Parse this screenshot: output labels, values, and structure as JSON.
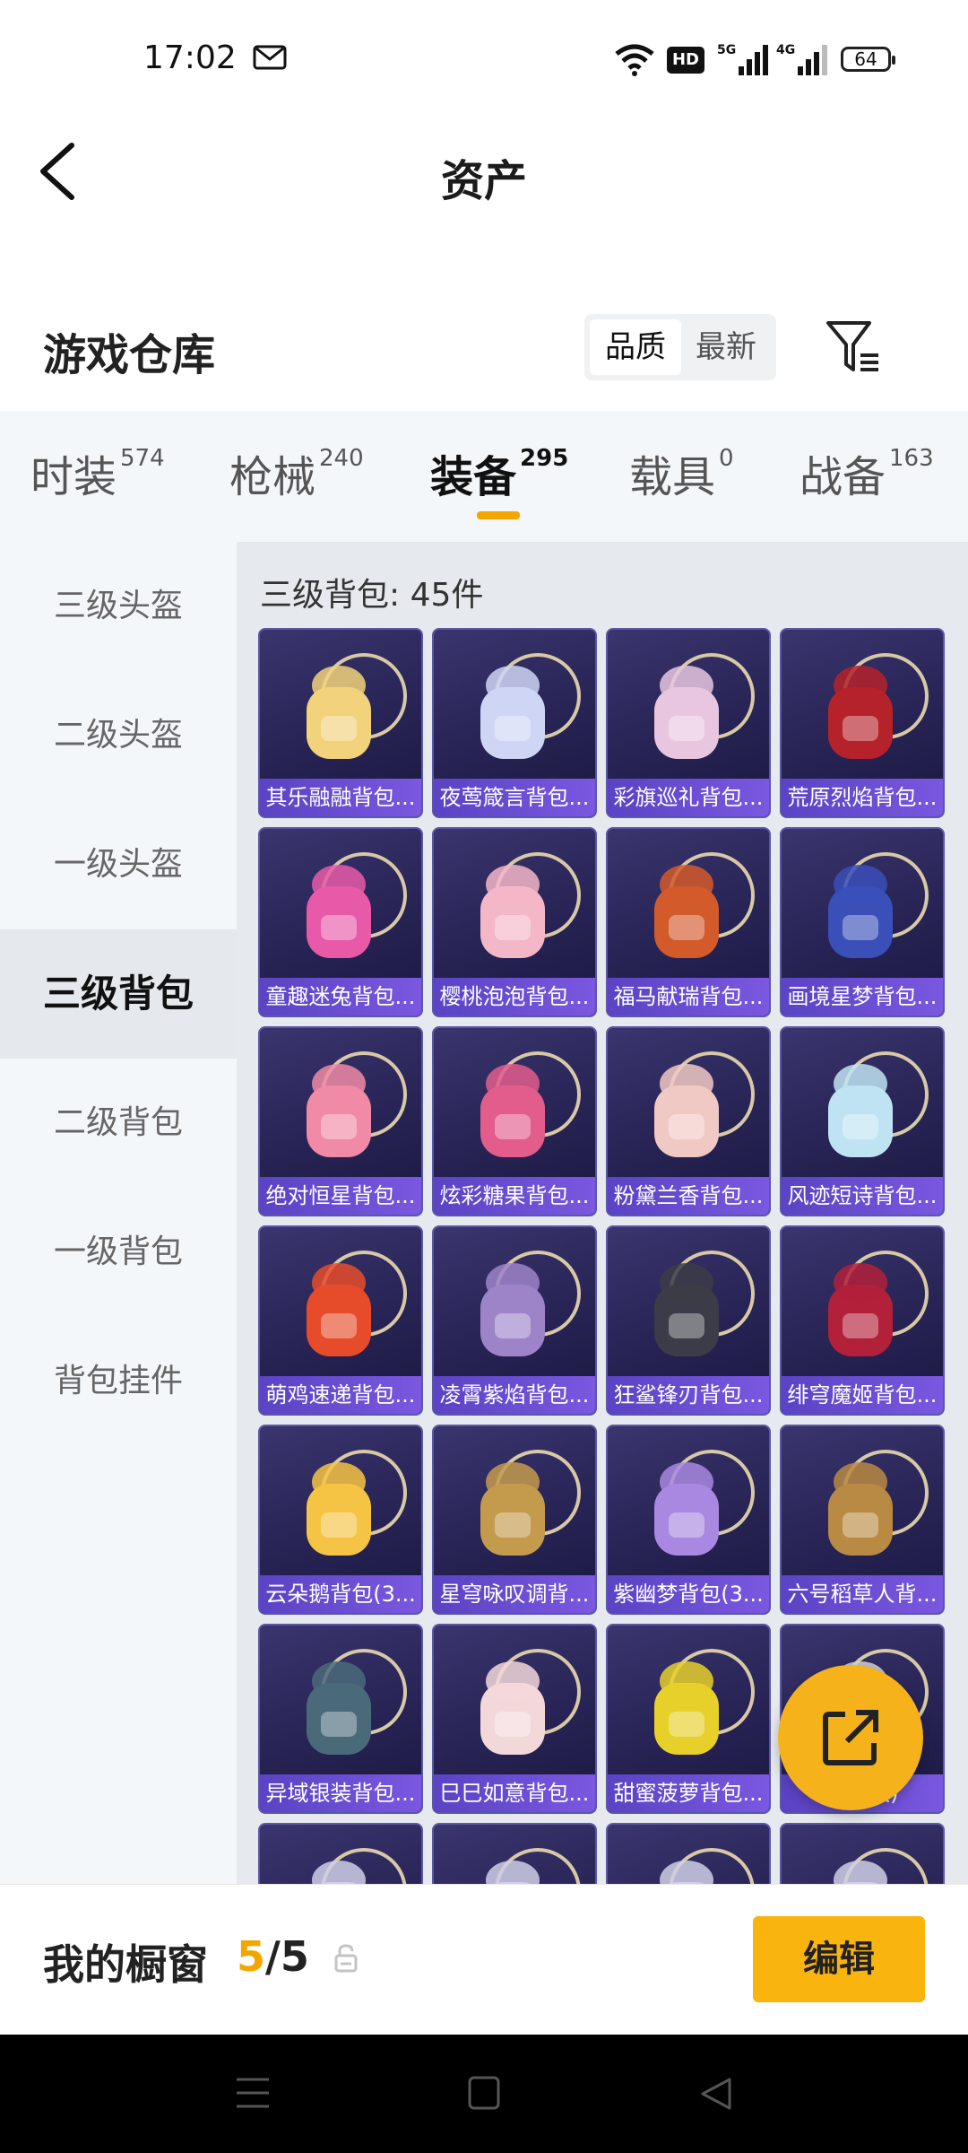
{
  "status_bar": {
    "time": "17:02",
    "hd": "HD",
    "battery": "64"
  },
  "header": {
    "title": "资产"
  },
  "section": {
    "title": "游戏仓库",
    "sort_options": [
      "品质",
      "最新"
    ]
  },
  "tabs": [
    {
      "label": "时装",
      "count": "574"
    },
    {
      "label": "枪械",
      "count": "240"
    },
    {
      "label": "装备",
      "count": "295",
      "active": true
    },
    {
      "label": "载具",
      "count": "0"
    },
    {
      "label": "战备",
      "count": "163"
    }
  ],
  "sidebar": [
    {
      "label": "三级头盔"
    },
    {
      "label": "二级头盔"
    },
    {
      "label": "一级头盔"
    },
    {
      "label": "三级背包",
      "active": true
    },
    {
      "label": "二级背包"
    },
    {
      "label": "一级背包"
    },
    {
      "label": "背包挂件"
    }
  ],
  "grid": {
    "header": "三级背包: 45件",
    "items": [
      {
        "name": "其乐融融背包...",
        "color": "#f2d27a"
      },
      {
        "name": "夜莺箴言背包...",
        "color": "#cfd6f5"
      },
      {
        "name": "彩旗巡礼背包...",
        "color": "#e8c6e0"
      },
      {
        "name": "荒原烈焰背包...",
        "color": "#b5222a"
      },
      {
        "name": "童趣迷兔背包...",
        "color": "#e85aa8"
      },
      {
        "name": "樱桃泡泡背包...",
        "color": "#f4b7c8"
      },
      {
        "name": "福马献瑞背包...",
        "color": "#d35a2b"
      },
      {
        "name": "画境星梦背包...",
        "color": "#3a4fb8"
      },
      {
        "name": "绝对恒星背包...",
        "color": "#f08aa6"
      },
      {
        "name": "炫彩糖果背包...",
        "color": "#e25d8c"
      },
      {
        "name": "粉黛兰香背包...",
        "color": "#f1c9c4"
      },
      {
        "name": "风迹短诗背包...",
        "color": "#bfe3f2"
      },
      {
        "name": "萌鸡速递背包...",
        "color": "#e64c2a"
      },
      {
        "name": "凌霄紫焰背包...",
        "color": "#9d84c9"
      },
      {
        "name": "狂鲨锋刃背包...",
        "color": "#3c3c48"
      },
      {
        "name": "绯穹魔姬背包...",
        "color": "#b2203a"
      },
      {
        "name": "云朵鹅背包(3...",
        "color": "#f6c444"
      },
      {
        "name": "星穹咏叹调背...",
        "color": "#c49a4d"
      },
      {
        "name": "紫幽梦背包(3...",
        "color": "#a888e0"
      },
      {
        "name": "六号稻草人背...",
        "color": "#b98a43"
      },
      {
        "name": "异域银装背包...",
        "color": "#4a6a7a"
      },
      {
        "name": "巳巳如意背包...",
        "color": "#f3d8da"
      },
      {
        "name": "甜蜜菠萝背包...",
        "color": "#e8d02a"
      },
      {
        "name": "...(3级)",
        "color": "#d4d4d4"
      }
    ]
  },
  "showcase": {
    "label": "我的橱窗",
    "current": "5",
    "separator": "/",
    "max": "5",
    "edit": "编辑"
  },
  "colors": {
    "accent": "#f5a500",
    "card_bg": "#2a2658",
    "card_label": "#6a4fd8"
  }
}
